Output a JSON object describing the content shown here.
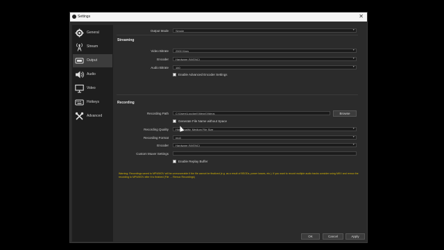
{
  "window": {
    "title": "Settings",
    "close_glyph": "✕"
  },
  "sidebar": {
    "items": [
      {
        "label": "General",
        "icon": "gear-icon",
        "active": false
      },
      {
        "label": "Stream",
        "icon": "broadcast-icon",
        "active": false
      },
      {
        "label": "Output",
        "icon": "output-icon",
        "active": true
      },
      {
        "label": "Audio",
        "icon": "speaker-icon",
        "active": false
      },
      {
        "label": "Video",
        "icon": "monitor-icon",
        "active": false
      },
      {
        "label": "Hotkeys",
        "icon": "keyboard-icon",
        "active": false
      },
      {
        "label": "Advanced",
        "icon": "tools-icon",
        "active": false
      }
    ]
  },
  "output_mode": {
    "label": "Output Mode",
    "value": "Simple"
  },
  "streaming": {
    "heading": "Streaming",
    "video_bitrate": {
      "label": "Video Bitrate",
      "value": "2500 Kbps"
    },
    "encoder": {
      "label": "Encoder",
      "value": "Hardware (NVENC)"
    },
    "audio_bitrate": {
      "label": "Audio Bitrate",
      "value": "160"
    },
    "advanced_encoder": {
      "label": "Enable Advanced Encoder Settings",
      "checked": false
    }
  },
  "recording": {
    "heading": "Recording",
    "path": {
      "label": "Recording Path",
      "value": "C:\\Users\\Loudan\\Videos\\Videos"
    },
    "browse": "Browse",
    "no_space": {
      "label": "Generate File Name without Space",
      "checked": false
    },
    "quality": {
      "label": "Recording Quality",
      "value": "High Quality, Medium File Size"
    },
    "format": {
      "label": "Recording Format",
      "value": "mp4"
    },
    "encoder": {
      "label": "Encoder",
      "value": "Hardware (NVENC)"
    },
    "muxer": {
      "label": "Custom Muxer Settings",
      "value": ""
    },
    "replay": {
      "label": "Enable Replay Buffer",
      "checked": false
    }
  },
  "warning_text": "Warning: Recordings saved to MP4/MOV will be unrecoverable if the file cannot be finalized (e.g. as a result of BSODs, power losses, etc.). If you want to record multiple audio tracks consider using MKV and remux the recording to MP4/MOV after it is finished (File → Remux Recordings)",
  "footer": {
    "ok": "OK",
    "cancel": "Cancel",
    "apply": "Apply"
  },
  "colors": {
    "warning": "#d9b800",
    "background": "#2b2b2b",
    "sidebar": "#1e1e1e"
  }
}
